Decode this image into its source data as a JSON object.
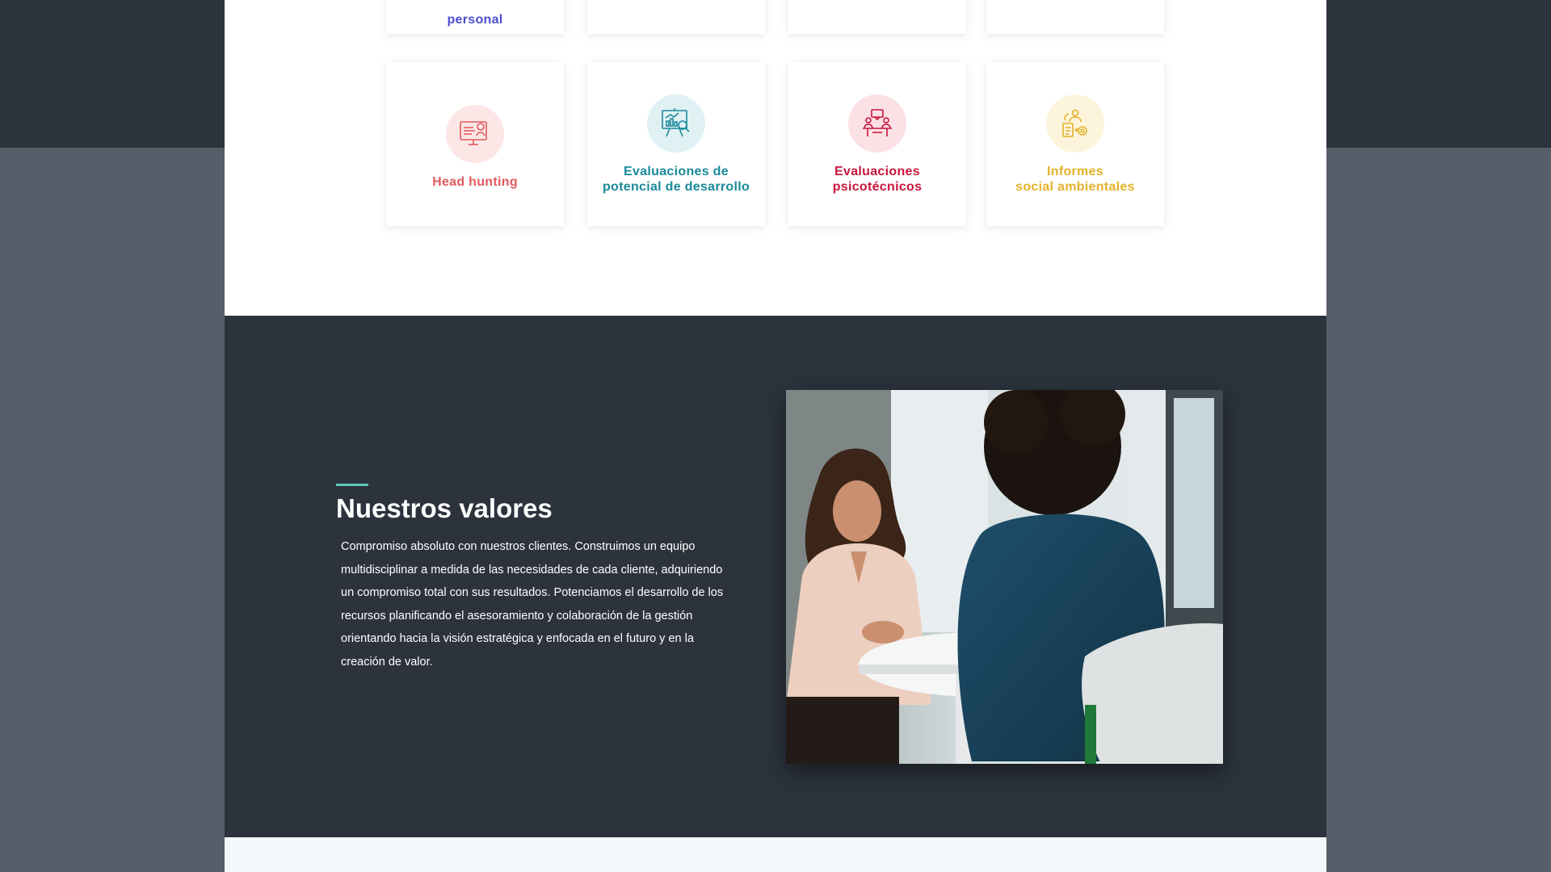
{
  "services": {
    "top_cards": [
      {
        "label": "personal",
        "color": "#4a4fd0"
      },
      {
        "label": ""
      },
      {
        "label": ""
      },
      {
        "label": ""
      }
    ],
    "cards": [
      {
        "icon": "monitor-candidate-icon",
        "label_lines": [
          "Head hunting"
        ],
        "color": "#e15a5e",
        "bg": "#fde6e6"
      },
      {
        "icon": "presentation-analysis-icon",
        "label_lines": [
          "Evaluaciones de",
          "potencial de desarrollo"
        ],
        "color": "#1a8a9a",
        "bg": "#e0f1f4"
      },
      {
        "icon": "interview-meeting-icon",
        "label_lines": [
          "Evaluaciones",
          "psicotécnicos"
        ],
        "color": "#c8163c",
        "bg": "#fbe1e6"
      },
      {
        "icon": "environment-report-icon",
        "label_lines": [
          "Informes",
          "social ambientales"
        ],
        "color": "#e3b22a",
        "bg": "#fdf4dc"
      }
    ]
  },
  "values": {
    "title": "Nuestros valores",
    "text": "Compromiso absoluto con nuestros clientes. Construimos un equipo multidisciplinar a medida de las necesidades de cada cliente, adquiriendo un compromiso total con sus resultados. Potenciamos el desarrollo de los recursos planificando el asesoramiento y colaboración de la gestión orientando hacia la visión estratégica y enfocada en el futuro y en la creación de valor.",
    "accent_color": "#5cc6b8"
  }
}
